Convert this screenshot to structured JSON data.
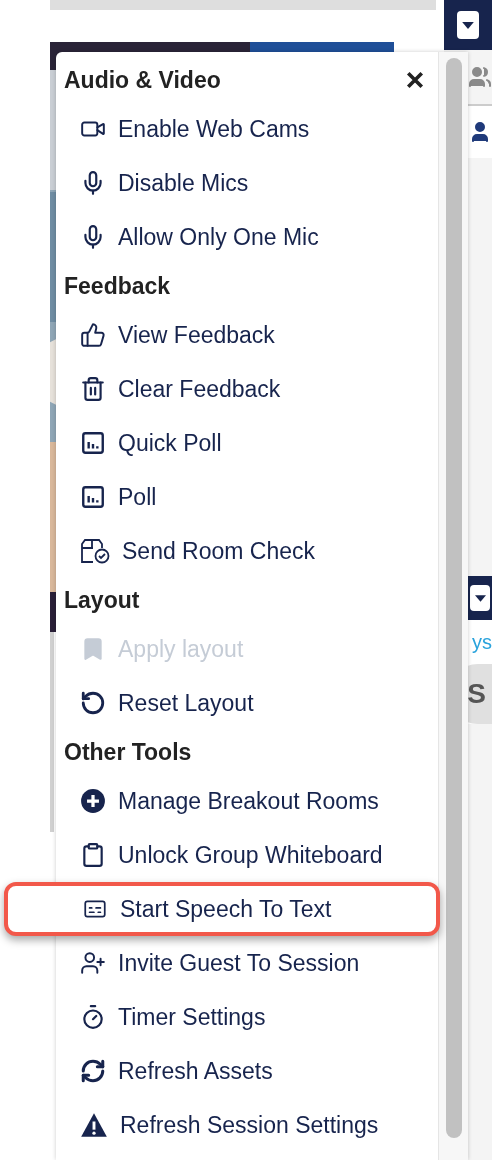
{
  "side_panel": {
    "link_text": "ys",
    "avatar_initials": "S"
  },
  "menu": {
    "sections": [
      {
        "title": "Audio & Video",
        "items": [
          {
            "label": "Enable Web Cams",
            "kind": "camera",
            "disabled": false,
            "highlighted": false
          },
          {
            "label": "Disable Mics",
            "kind": "mic",
            "disabled": false,
            "highlighted": false
          },
          {
            "label": "Allow Only One Mic",
            "kind": "mic",
            "disabled": false,
            "highlighted": false
          }
        ]
      },
      {
        "title": "Feedback",
        "items": [
          {
            "label": "View Feedback",
            "kind": "thumbs-up",
            "disabled": false,
            "highlighted": false
          },
          {
            "label": "Clear Feedback",
            "kind": "trash",
            "disabled": false,
            "highlighted": false
          },
          {
            "label": "Quick Poll",
            "kind": "chart",
            "disabled": false,
            "highlighted": false
          },
          {
            "label": "Poll",
            "kind": "chart",
            "disabled": false,
            "highlighted": false
          },
          {
            "label": "Send Room Check",
            "kind": "room-check",
            "disabled": false,
            "highlighted": false
          }
        ]
      },
      {
        "title": "Layout",
        "items": [
          {
            "label": "Apply layout",
            "kind": "bookmark",
            "disabled": true,
            "highlighted": false
          },
          {
            "label": "Reset Layout",
            "kind": "reset",
            "disabled": false,
            "highlighted": false
          }
        ]
      },
      {
        "title": "Other Tools",
        "items": [
          {
            "label": "Manage Breakout Rooms",
            "kind": "plus-circle",
            "disabled": false,
            "highlighted": false
          },
          {
            "label": "Unlock Group Whiteboard",
            "kind": "clipboard",
            "disabled": false,
            "highlighted": false
          },
          {
            "label": "Start Speech To Text",
            "kind": "captions",
            "disabled": false,
            "highlighted": true
          },
          {
            "label": "Invite Guest To Session",
            "kind": "user-plus",
            "disabled": false,
            "highlighted": false
          },
          {
            "label": "Timer Settings",
            "kind": "timer",
            "disabled": false,
            "highlighted": false
          },
          {
            "label": "Refresh Assets",
            "kind": "refresh",
            "disabled": false,
            "highlighted": false
          },
          {
            "label": "Refresh Session Settings",
            "kind": "warning",
            "disabled": false,
            "highlighted": false
          }
        ]
      }
    ]
  }
}
